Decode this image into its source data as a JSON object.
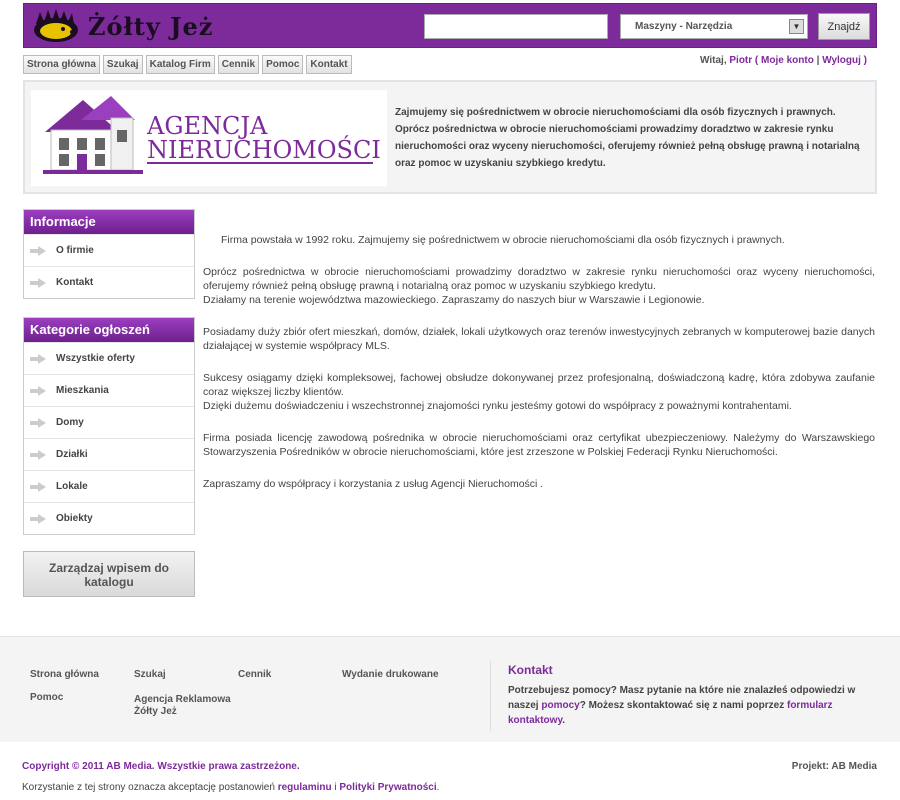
{
  "header": {
    "logo_text": "Żółty Jeż",
    "search_placeholder": "",
    "category_selected": "Maszyny - Narzędzia",
    "find_label": "Znajdź"
  },
  "nav": {
    "items": [
      "Strona główna",
      "Szukaj",
      "Katalog Firm",
      "Cennik",
      "Pomoc",
      "Kontakt"
    ]
  },
  "user_bar": {
    "greeting": "Witaj,",
    "user": "Piotr",
    "open_paren": " ( ",
    "my_account": "Moje konto",
    "separator": " | ",
    "logout": "Wyloguj",
    "close_paren": " )"
  },
  "banner": {
    "logo_line1": "AGENCJA",
    "logo_line2": "NIERUCHOMOŚCI",
    "description": "Zajmujemy się pośrednictwem w obrocie nieruchomościami dla osób fizycznych i prawnych. Oprócz pośrednictwa w obrocie nieruchomościami prowadzimy doradztwo w zakresie rynku nieruchomości oraz wyceny nieruchomości, oferujemy również pełną obsługę prawną i notarialną oraz pomoc w uzyskaniu szybkiego kredytu."
  },
  "sidebar": {
    "info": {
      "title": "Informacje",
      "items": [
        "O firmie",
        "Kontakt"
      ]
    },
    "categories": {
      "title": "Kategorie ogłoszeń",
      "items": [
        "Wszystkie oferty",
        "Mieszkania",
        "Domy",
        "Działki",
        "Lokale",
        "Obiekty"
      ]
    },
    "manage_button": "Zarządzaj wpisem do katalogu"
  },
  "content": {
    "p1": "Firma powstała w 1992 roku. Zajmujemy się pośrednictwem w obrocie nieruchomościami dla osób fizycznych i prawnych.",
    "p2a": "Oprócz pośrednictwa w obrocie nieruchomościami prowadzimy doradztwo w zakresie rynku nieruchomości oraz wyceny nieruchomości, oferujemy również pełną obsługę prawną i notarialną oraz pomoc w uzyskaniu szybkiego kredytu.",
    "p2b": "Działamy na terenie województwa mazowieckiego. Zapraszamy do naszych biur w Warszawie i Legionowie.",
    "p3": "Posiadamy duży zbiór ofert mieszkań, domów, działek, lokali użytkowych oraz terenów inwestycyjnych zebranych w komputerowej bazie danych działającej w systemie współpracy MLS.",
    "p4a": "Sukcesy osiągamy dzięki kompleksowej, fachowej obsłudze dokonywanej przez profesjonalną, doświadczoną kadrę, która zdobywa zaufanie coraz większej liczby klientów.",
    "p4b": "Dzięki dużemu doświadczeniu i wszechstronnej znajomości rynku jesteśmy gotowi do współpracy z poważnymi kontrahentami.",
    "p5": "Firma posiada licencję zawodową pośrednika w obrocie nieruchomościami oraz certyfikat ubezpieczeniowy. Należymy do Warszawskiego Stowarzyszenia Pośredników w obrocie nieruchomościami, które jest zrzeszone w Polskiej Federacji Rynku Nieruchomości.",
    "p6": "Zapraszamy do współpracy i korzystania z usług Agencji Nieruchomości ."
  },
  "footer": {
    "links": {
      "home": "Strona główna",
      "search": "Szukaj",
      "pricing": "Cennik",
      "print": "Wydanie drukowane",
      "help": "Pomoc",
      "agency_line1": "Agencja Reklamowa",
      "agency_line2": "Żółty Jeż"
    },
    "contact_title": "Kontakt",
    "contact_text1": "Potrzebujesz pomocy? Masz pytanie na które nie znalazłeś odpowiedzi w naszej ",
    "contact_link1": "pomocy",
    "contact_text2": "? Możesz skontaktować się z nami poprzez ",
    "contact_link2": "formularz kontaktowy",
    "contact_text3": "."
  },
  "bottom": {
    "copyright": "Copyright © 2011 AB Media. Wszystkie prawa zastrzeżone.",
    "project": "Projekt: AB Media",
    "terms_text1": "Korzystanie z tej strony oznacza akceptację postanowień ",
    "terms_link1": "regulaminu",
    "terms_text2": " i ",
    "terms_link2": "Polityki Prywatności",
    "terms_text3": "."
  },
  "colors": {
    "brand_purple": "#7d2a9b",
    "logo_yellow": "#e6c200"
  }
}
